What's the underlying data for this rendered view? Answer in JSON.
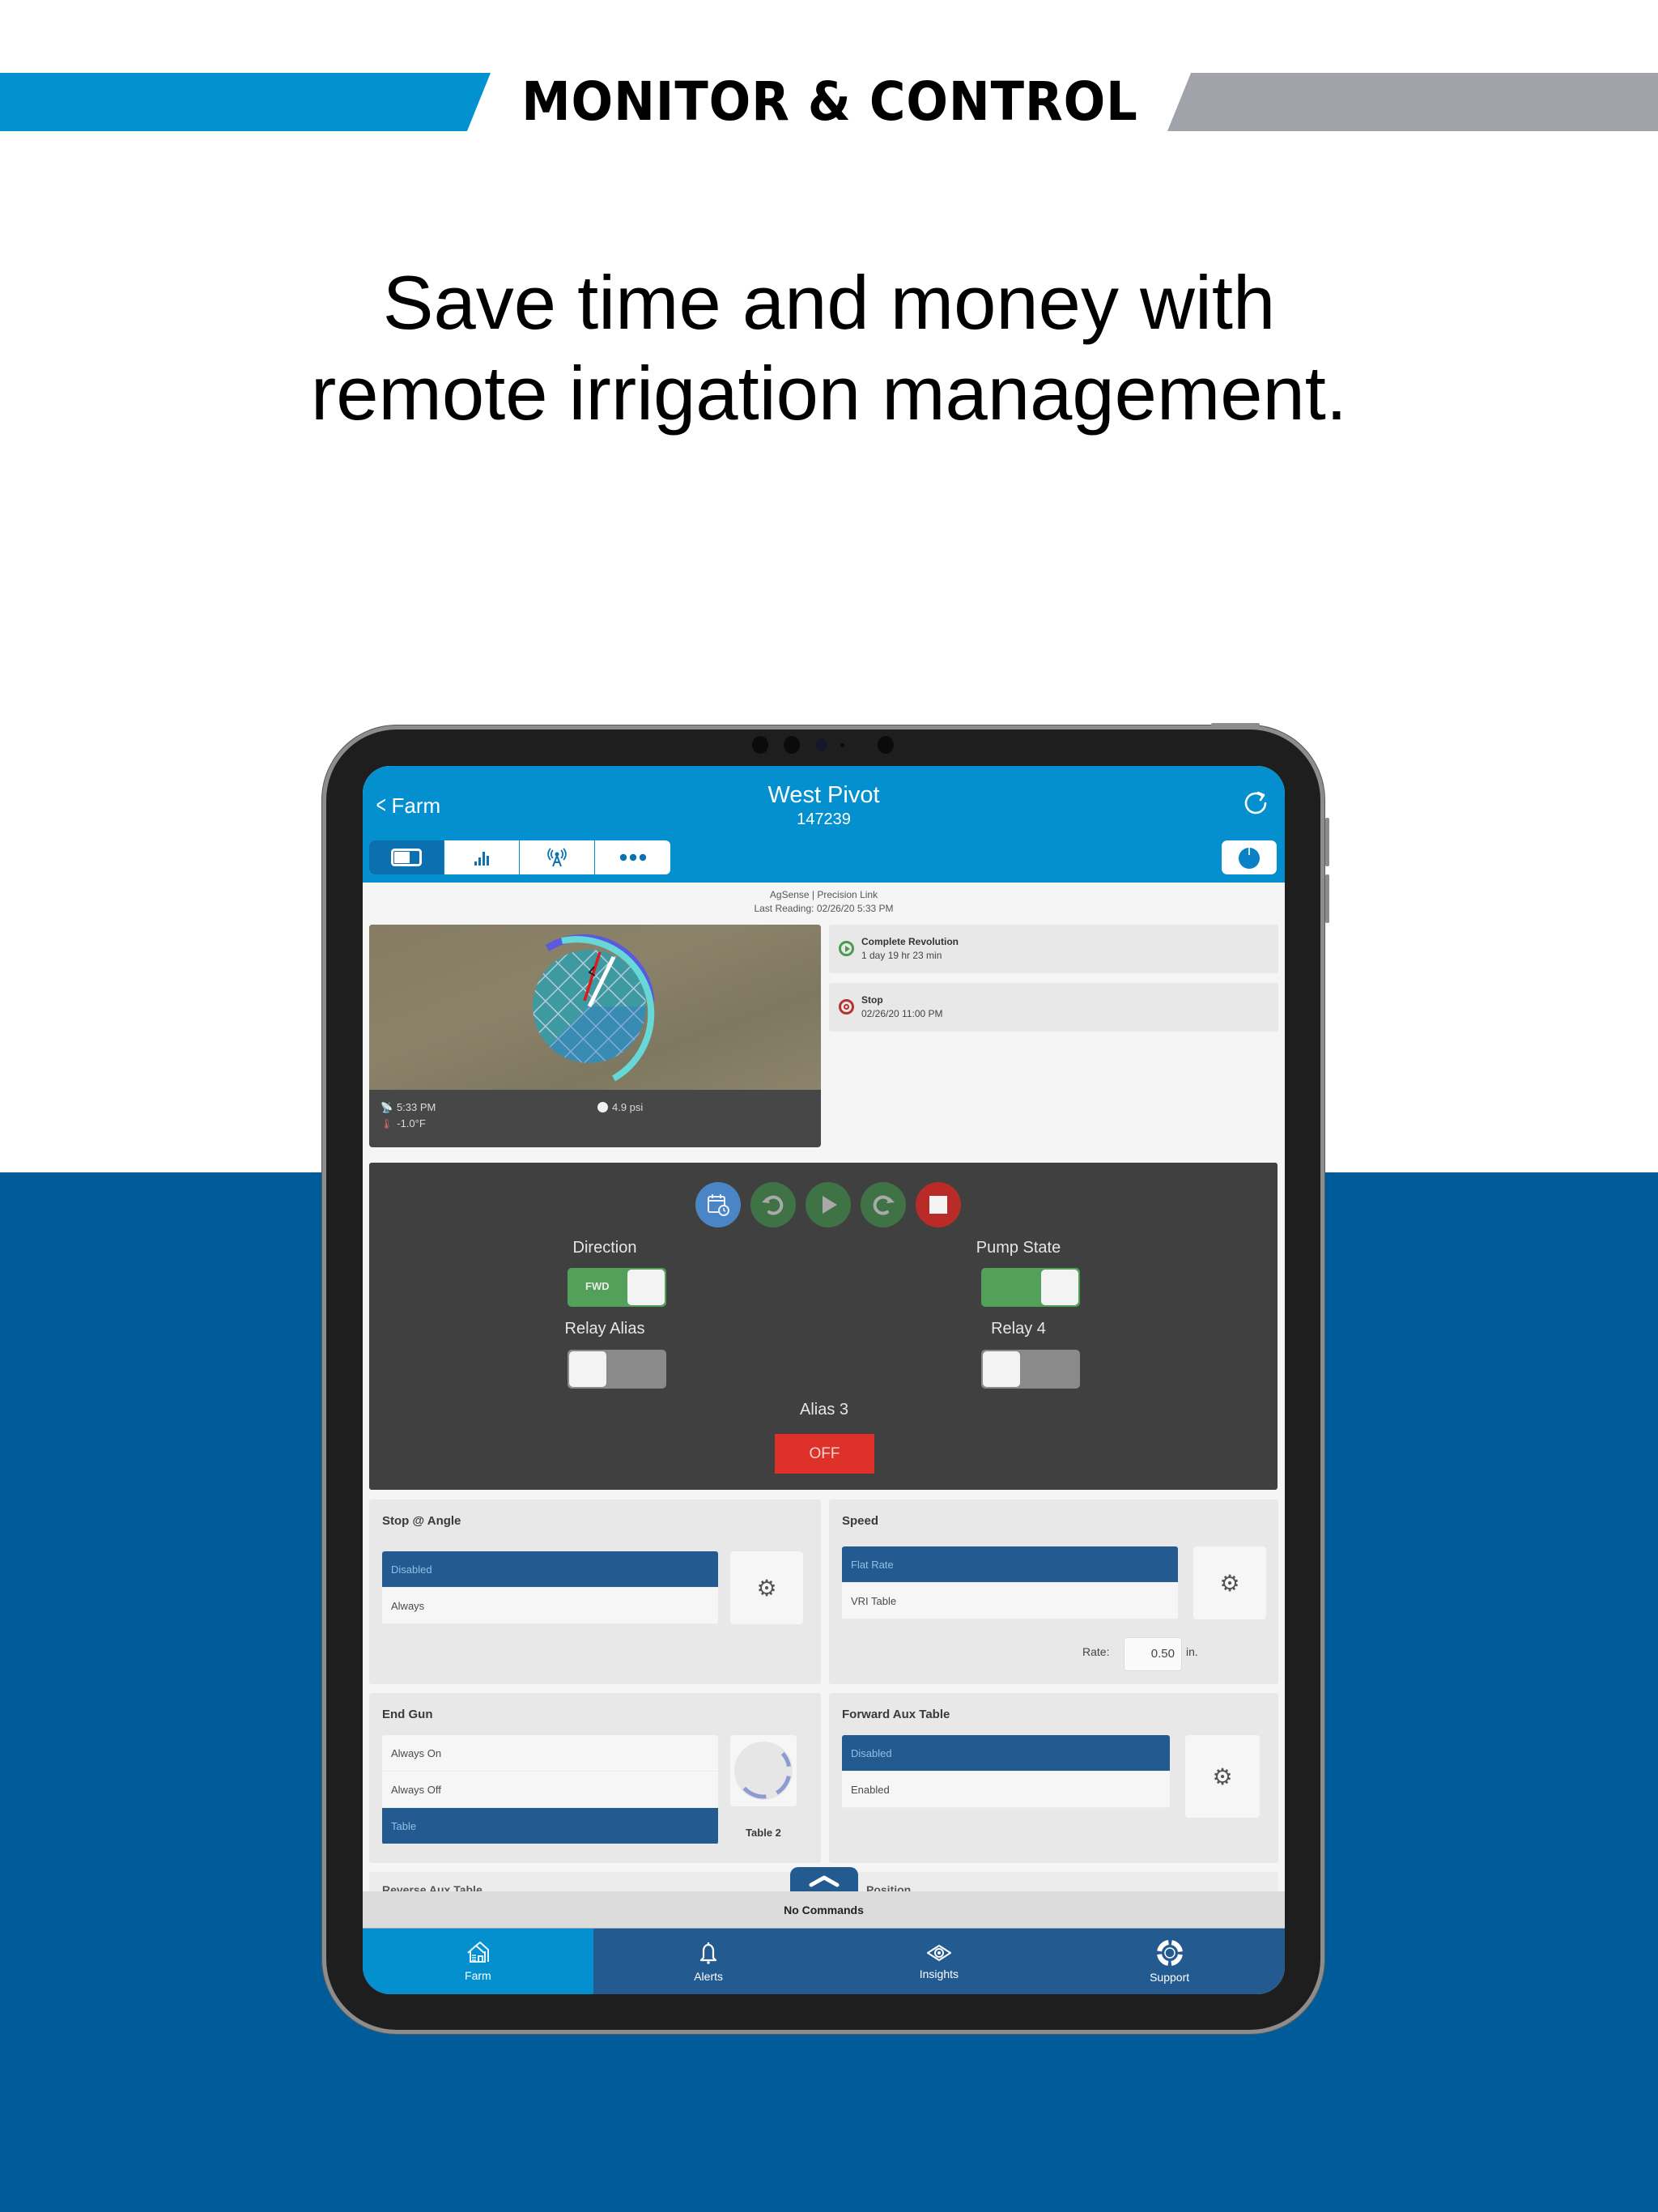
{
  "banner": {
    "title": "MONITOR & CONTROL",
    "colors": {
      "left_bar": "#0392d0",
      "right_bar": "#a1a3ab",
      "band": "#005b9a"
    }
  },
  "headline": {
    "line1": "Save time and money with",
    "line2": "remote irrigation management."
  },
  "app": {
    "header": {
      "back_label": "Farm",
      "title": "West Pivot",
      "subtitle": "147239",
      "refresh_icon": "refresh-icon",
      "power_icon": "power-dial-icon"
    },
    "segments": [
      {
        "icon": "toggle-view-icon",
        "active": true
      },
      {
        "icon": "bar-chart-icon",
        "active": false
      },
      {
        "icon": "antenna-icon",
        "active": false
      },
      {
        "icon": "more-dots-icon",
        "active": false
      }
    ],
    "brand_line": "AgSense | Precision Link",
    "last_reading": "Last Reading: 02/26/20 5:33 PM",
    "map_card": {
      "time": "5:33 PM",
      "temperature": "-1.0°F",
      "pressure": "4.9 psi"
    },
    "status_cards": [
      {
        "title": "Complete Revolution",
        "detail": "1 day 19 hr 23 min",
        "icon": "play-circle-icon",
        "color": "#4a9a4f"
      },
      {
        "title": "Stop",
        "detail": "02/26/20 11:00 PM",
        "icon": "stop-circle-icon",
        "color": "#b8322d"
      }
    ],
    "control_panel": {
      "buttons": [
        {
          "name": "schedule",
          "icon": "calendar-clock-icon",
          "color": "#4a86c5"
        },
        {
          "name": "reverse",
          "icon": "rotate-left-icon",
          "color": "#3f7346"
        },
        {
          "name": "start",
          "icon": "play-icon",
          "color": "#3f7346"
        },
        {
          "name": "forward",
          "icon": "rotate-right-icon",
          "color": "#3f7346"
        },
        {
          "name": "stop",
          "icon": "stop-icon",
          "color": "#b92b27"
        }
      ],
      "direction": {
        "label": "Direction",
        "state_label": "FWD",
        "on": true
      },
      "pump_state": {
        "label": "Pump State",
        "on": true
      },
      "relay_alias": {
        "label": "Relay Alias",
        "on": false
      },
      "relay_4": {
        "label": "Relay 4",
        "on": false
      },
      "alias_3": {
        "label": "Alias 3",
        "button_label": "OFF"
      }
    },
    "stop_at_angle": {
      "title": "Stop @ Angle",
      "options": [
        "Disabled",
        "Always"
      ],
      "selected": "Disabled"
    },
    "speed": {
      "title": "Speed",
      "options": [
        "Flat Rate",
        "VRI Table"
      ],
      "selected": "Flat Rate",
      "rate_label": "Rate:",
      "rate_value": "0.50",
      "rate_unit": "in."
    },
    "end_gun": {
      "title": "End Gun",
      "options": [
        "Always On",
        "Always Off",
        "Table"
      ],
      "selected": "Table",
      "table_label": "Table 2"
    },
    "forward_aux_table": {
      "title": "Forward Aux Table",
      "options": [
        "Disabled",
        "Enabled"
      ],
      "selected": "Disabled"
    },
    "peek": {
      "left_title": "Reverse Aux Table",
      "right_title": "Position"
    },
    "command_bar": "No Commands",
    "tabbar": [
      {
        "label": "Farm",
        "icon": "farm-house-icon",
        "active": true
      },
      {
        "label": "Alerts",
        "icon": "bell-icon",
        "active": false
      },
      {
        "label": "Insights",
        "icon": "eye-icon",
        "active": false
      },
      {
        "label": "Support",
        "icon": "lifebuoy-icon",
        "active": false
      }
    ]
  }
}
